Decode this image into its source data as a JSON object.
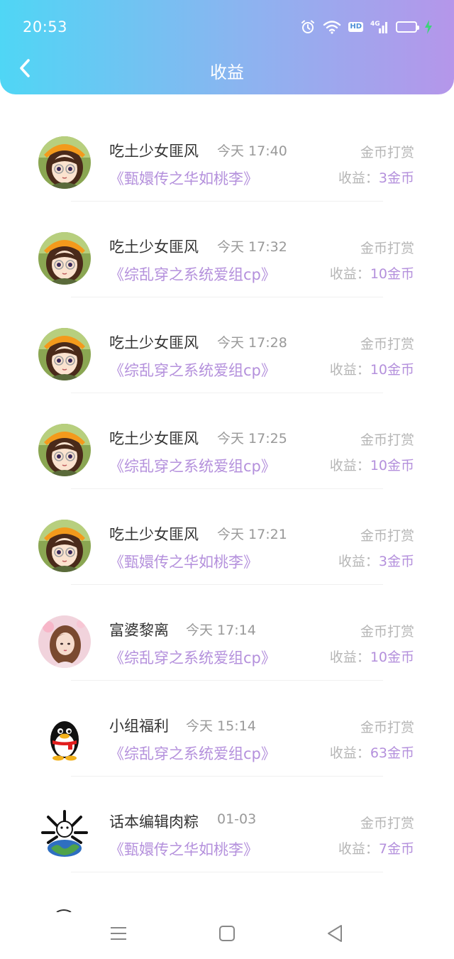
{
  "status_bar": {
    "time": "20:53",
    "hd_label": "HD",
    "network": "4G",
    "battery_level": 0.75,
    "icons": [
      "alarm-icon",
      "wifi-icon",
      "hd-icon",
      "signal-icon",
      "battery-icon",
      "charging-icon"
    ]
  },
  "header": {
    "title": "收益",
    "back_icon": "chevron-left-icon"
  },
  "income_prefix": "收益：",
  "records": [
    {
      "name": "吃土少女匪风",
      "time": "今天 17:40",
      "book": "《甄嬛传之华如桃李》",
      "type": "金币打赏",
      "amount": "3金币",
      "avatar": "anime-girl"
    },
    {
      "name": "吃土少女匪风",
      "time": "今天 17:32",
      "book": "《综乱穿之系统爱组cp》",
      "type": "金币打赏",
      "amount": "10金币",
      "avatar": "anime-girl"
    },
    {
      "name": "吃土少女匪风",
      "time": "今天 17:28",
      "book": "《综乱穿之系统爱组cp》",
      "type": "金币打赏",
      "amount": "10金币",
      "avatar": "anime-girl"
    },
    {
      "name": "吃土少女匪风",
      "time": "今天 17:25",
      "book": "《综乱穿之系统爱组cp》",
      "type": "金币打赏",
      "amount": "10金币",
      "avatar": "anime-girl"
    },
    {
      "name": "吃土少女匪风",
      "time": "今天 17:21",
      "book": "《甄嬛传之华如桃李》",
      "type": "金币打赏",
      "amount": "3金币",
      "avatar": "anime-girl"
    },
    {
      "name": "富婆黎离",
      "time": "今天 17:14",
      "book": "《综乱穿之系统爱组cp》",
      "type": "金币打赏",
      "amount": "10金币",
      "avatar": "painted-girl"
    },
    {
      "name": "小组福利",
      "time": "今天 15:14",
      "book": "《综乱穿之系统爱组cp》",
      "type": "金币打赏",
      "amount": "63金币",
      "avatar": "penguin"
    },
    {
      "name": "话本编辑肉粽",
      "time": "01-03",
      "book": "《甄嬛传之华如桃李》",
      "type": "金币打赏",
      "amount": "7金币",
      "avatar": "earth-logo"
    }
  ],
  "nav_bar": {
    "icons": [
      "menu-icon",
      "home-icon",
      "back-icon"
    ]
  },
  "colors": {
    "header_gradient": [
      "#4fd6f5",
      "#b596ea"
    ],
    "accent": "#b490dc",
    "muted": "#b6b6b6"
  }
}
